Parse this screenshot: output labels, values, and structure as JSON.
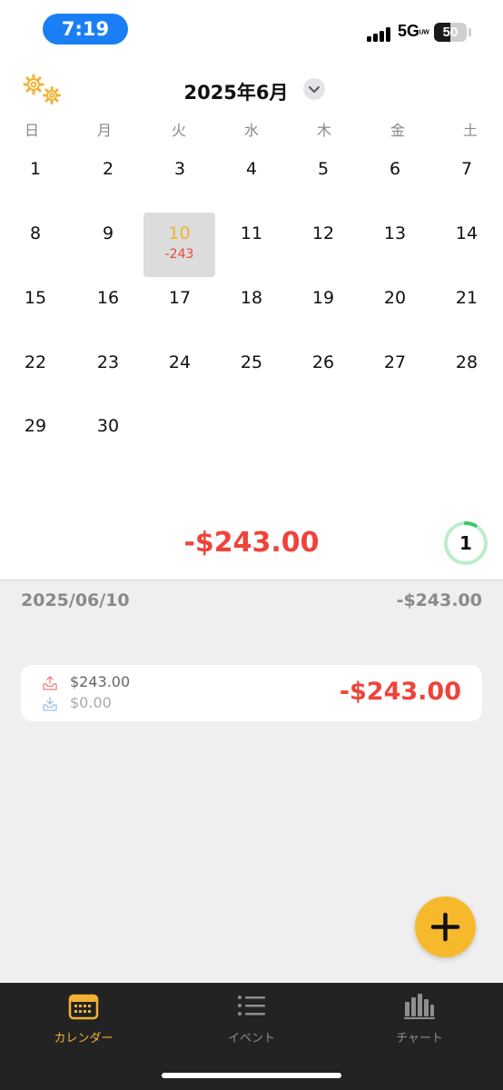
{
  "status_bar": {
    "time": "7:19",
    "network": "5GUW",
    "battery_level": "50",
    "battery_fraction": 0.5
  },
  "header": {
    "month_title": "2025年6月",
    "settings_icon": "gears-icon",
    "dropdown_icon": "chevron-down-icon"
  },
  "weekdays": [
    "日",
    "月",
    "火",
    "水",
    "木",
    "金",
    "土"
  ],
  "calendar": {
    "selected_day": "10",
    "selected_amount": "-243",
    "days": [
      "1",
      "2",
      "3",
      "4",
      "5",
      "6",
      "7",
      "8",
      "9",
      "10",
      "11",
      "12",
      "13",
      "14",
      "15",
      "16",
      "17",
      "18",
      "19",
      "20",
      "21",
      "22",
      "23",
      "24",
      "25",
      "26",
      "27",
      "28",
      "29",
      "30"
    ]
  },
  "summary": {
    "total": "-$243.00",
    "entry_count": "1",
    "progress_fraction": 0.08
  },
  "day_detail": {
    "date": "2025/06/10",
    "date_total": "-$243.00",
    "entry": {
      "expense": "$243.00",
      "income": "$0.00",
      "net": "-$243.00",
      "expense_icon": "tray-out-icon",
      "income_icon": "tray-in-icon"
    }
  },
  "fab": {
    "icon": "plus-icon"
  },
  "tabs": [
    {
      "label": "カレンダー",
      "icon": "calendar-icon",
      "active": true
    },
    {
      "label": "イベント",
      "icon": "list-icon",
      "active": false
    },
    {
      "label": "チャート",
      "icon": "bar-chart-icon",
      "active": false
    }
  ],
  "colors": {
    "accent": "#f2b233",
    "negative": "#f0433a",
    "status_pill": "#1a7ff5",
    "tab_bar": "#232323",
    "progress": "#3cc96b"
  }
}
